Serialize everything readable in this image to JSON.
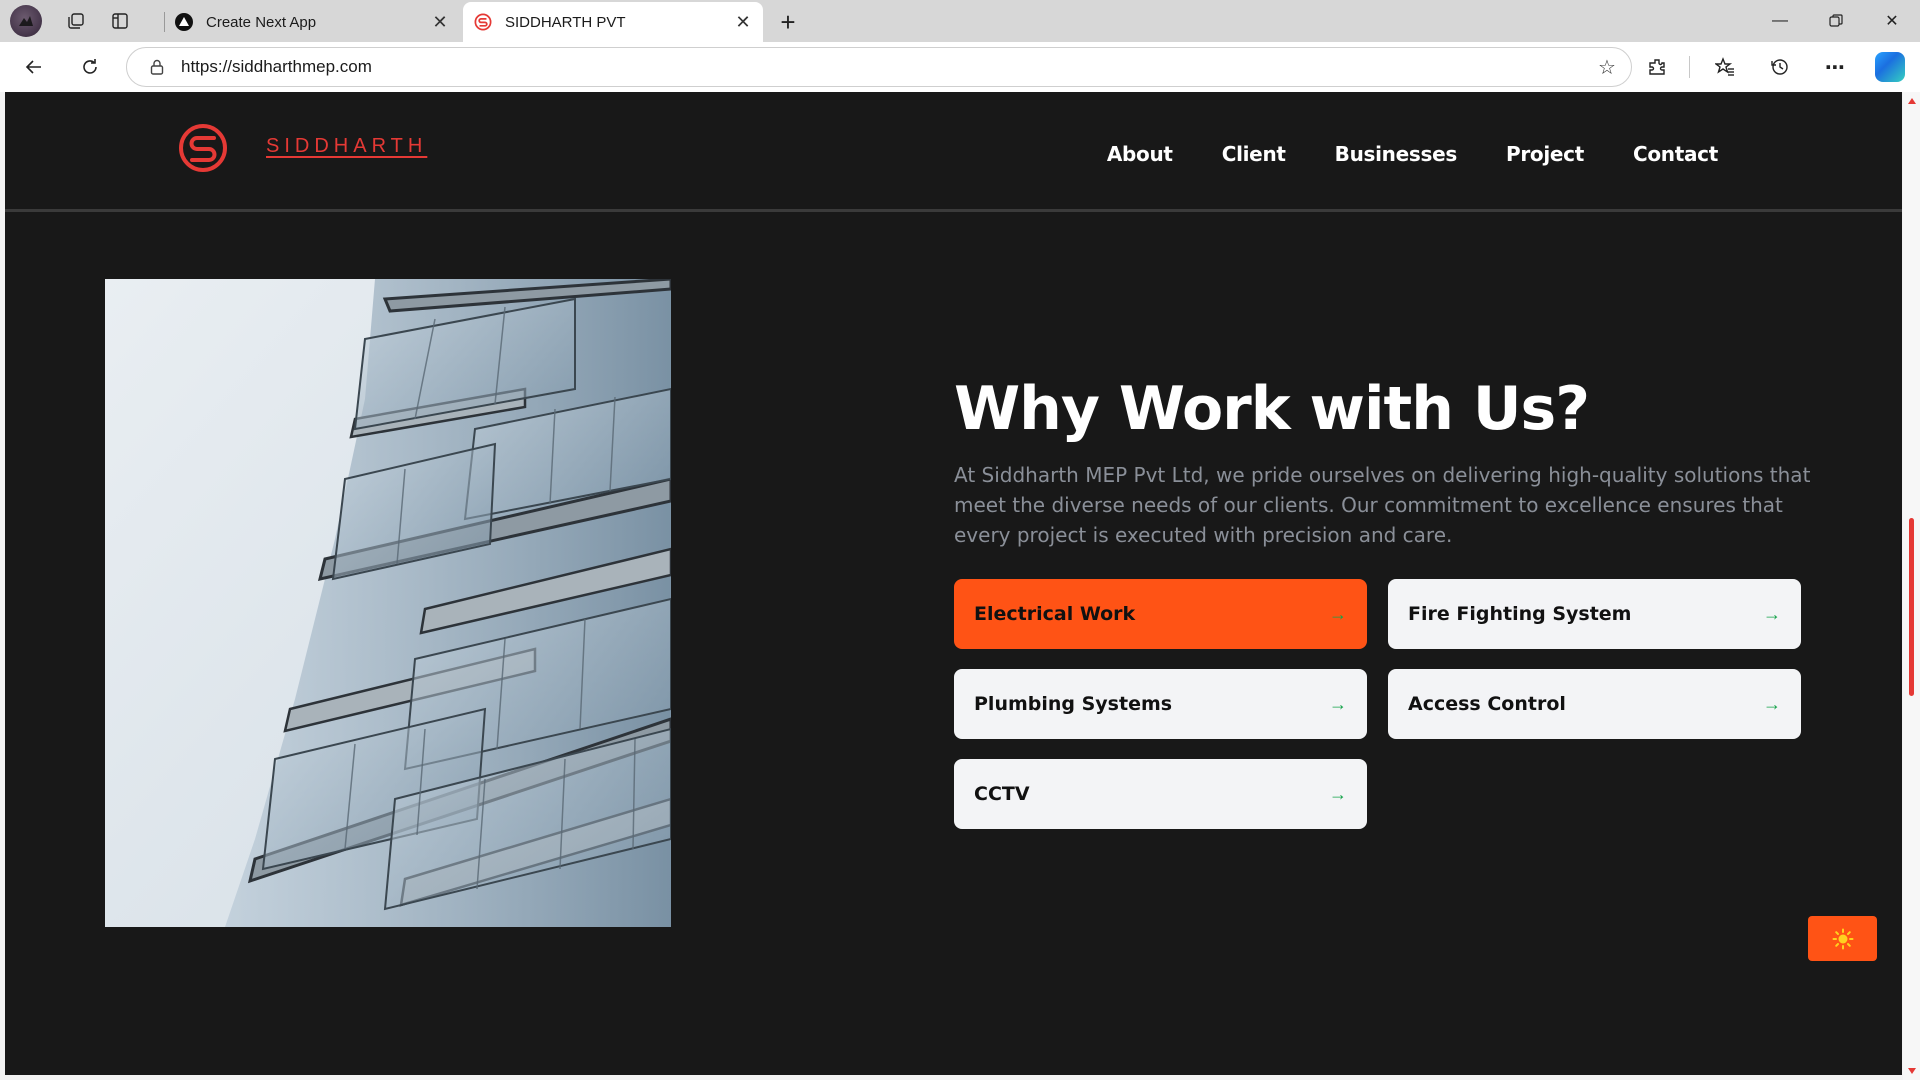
{
  "browser": {
    "tabs": [
      {
        "title": "Create Next App",
        "active": false,
        "favicon": "nextjs-icon"
      },
      {
        "title": "SIDDHARTH PVT",
        "active": true,
        "favicon": "siddharth-logo-icon"
      }
    ],
    "url": "https://siddharthmep.com",
    "accent": "#e53935"
  },
  "site": {
    "brand": "SIDDHARTH",
    "brand_color": "#e53935",
    "nav": [
      "About",
      "Client",
      "Businesses",
      "Project",
      "Contact"
    ]
  },
  "section": {
    "heading": "Why Work with Us?",
    "description": "At Siddharth MEP Pvt Ltd, we pride ourselves on delivering high-quality solutions that meet the diverse needs of our clients. Our commitment to excellence ensures that every project is executed with precision and care.",
    "services": [
      {
        "label": "Electrical Work",
        "highlighted": true
      },
      {
        "label": "Fire Fighting System",
        "highlighted": false
      },
      {
        "label": "Plumbing Systems",
        "highlighted": false
      },
      {
        "label": "Access Control",
        "highlighted": false
      },
      {
        "label": "CCTV",
        "highlighted": false
      }
    ],
    "arrow": "→",
    "highlight_color": "#ff5315",
    "arrow_color": "#16a34a"
  },
  "theme_toggle": {
    "icon": "sun-icon",
    "glyph": "☀"
  }
}
